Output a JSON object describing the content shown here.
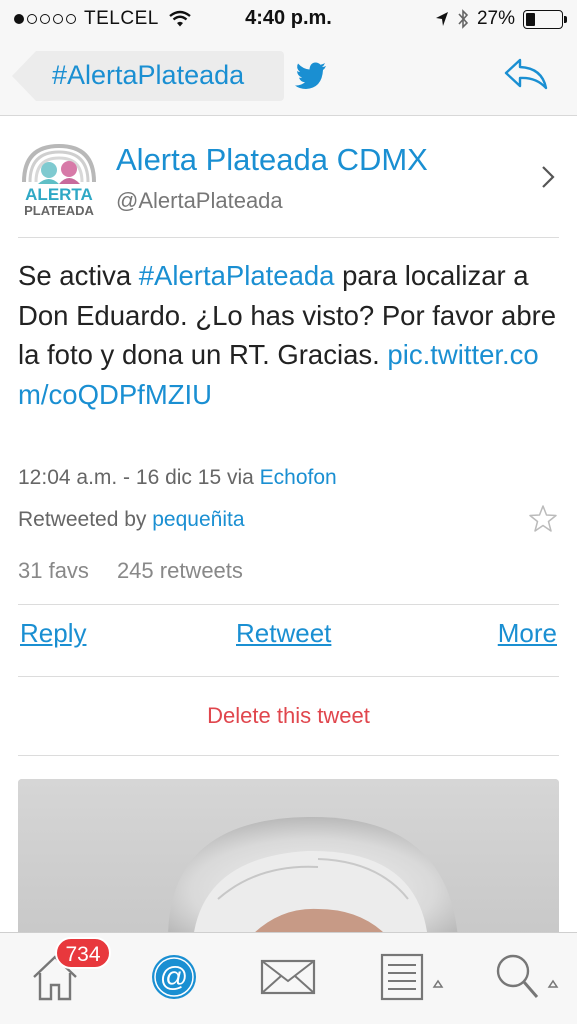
{
  "status_bar": {
    "carrier": "TELCEL",
    "time": "4:40 p.m.",
    "battery": "27%"
  },
  "nav": {
    "title": "#AlertaPlateada"
  },
  "author": {
    "name": "Alerta Plateada CDMX",
    "handle": "@AlertaPlateada",
    "avatar_text_top": "ALERTA",
    "avatar_text_bottom": "PLATEADA"
  },
  "tweet": {
    "text_1": "Se activa ",
    "hashtag": "#AlertaPlateada",
    "text_2": " para localizar a Don Eduardo. ¿Lo has visto? Por favor abre la foto y dona un RT. Gracias. ",
    "link": "pic.twitter.com/coQDPfMZIU",
    "timestamp": "12:04 a.m. - 16 dic 15 via ",
    "client": "Echofon",
    "retweeted_label": "Retweeted by ",
    "retweeted_by": "pequeñita",
    "favs": "31 favs",
    "retweets": "245 retweets"
  },
  "actions": {
    "reply": "Reply",
    "retweet": "Retweet",
    "more": "More",
    "delete": "Delete this tweet"
  },
  "tab_bar": {
    "badge": "734",
    "tabs": [
      "home-icon",
      "mentions-icon",
      "messages-icon",
      "lists-icon",
      "search-icon"
    ]
  },
  "colors": {
    "accent": "#1a8fd2",
    "delete": "#e0464d",
    "badge": "#e8383d"
  }
}
